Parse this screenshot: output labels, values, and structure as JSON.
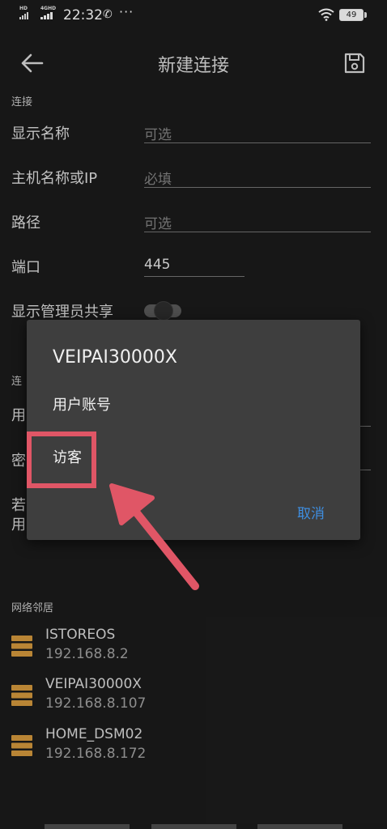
{
  "status_bar": {
    "net_left": "HD",
    "net_signal": "4GHD",
    "time": "22:32",
    "battery": "49"
  },
  "app_bar": {
    "title": "新建连接"
  },
  "form": {
    "connection_section": "连接",
    "display_name_label": "显示名称",
    "display_name_placeholder": "可选",
    "host_label": "主机名称或IP",
    "host_placeholder": "必填",
    "path_label": "路径",
    "path_placeholder": "可选",
    "port_label": "端口",
    "port_value": "445",
    "show_admin_label": "显示管理员共享",
    "partial_section": "连",
    "partial_user": "用",
    "partial_password": "密",
    "partial_note_1": "若",
    "partial_note_2": "用"
  },
  "network": {
    "section_label": "网络邻居",
    "servers": [
      {
        "name": "ISTOREOS",
        "ip": "192.168.8.2"
      },
      {
        "name": "VEIPAI30000X",
        "ip": "192.168.8.107"
      },
      {
        "name": "HOME_DSM02",
        "ip": "192.168.8.172"
      }
    ]
  },
  "dialog": {
    "title": "VEIPAI30000X",
    "option_user": "用户账号",
    "option_guest": "访客",
    "cancel": "取消"
  },
  "colors": {
    "background": "#1a1a1a",
    "dialog": "#3e3e3e",
    "accent_blue": "#3e8ee0",
    "annotation_red": "#e05666",
    "server_icon": "#c9913a"
  }
}
